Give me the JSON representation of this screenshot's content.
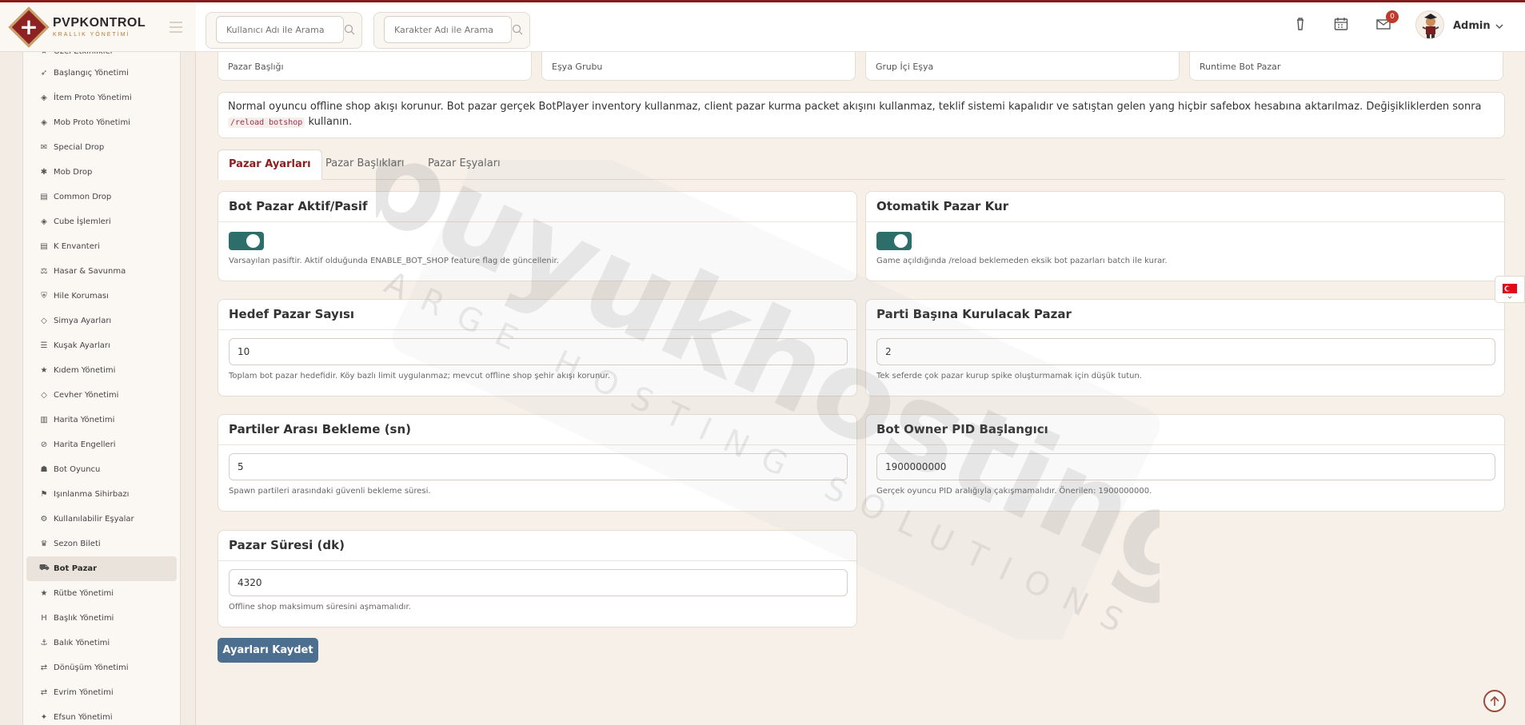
{
  "brand": {
    "name": "PVPKONTROL",
    "subtitle": "KRALLIK YÖNETİMİ"
  },
  "header": {
    "search_user_placeholder": "Kullanıcı Adı ile Arama",
    "search_char_placeholder": "Karakter Adı ile Arama",
    "notification_count": "0",
    "user_name": "Admin"
  },
  "sidebar": {
    "items": [
      {
        "label": "Özel Etkinlikler",
        "icon": "star-icon"
      },
      {
        "label": "Başlangıç Yönetimi",
        "icon": "rocket-icon"
      },
      {
        "label": "İtem Proto Yönetimi",
        "icon": "cube-icon"
      },
      {
        "label": "Mob Proto Yönetimi",
        "icon": "cube-icon"
      },
      {
        "label": "Special Drop",
        "icon": "gift-icon"
      },
      {
        "label": "Mob Drop",
        "icon": "bug-icon"
      },
      {
        "label": "Common Drop",
        "icon": "table-icon"
      },
      {
        "label": "Cube İşlemleri",
        "icon": "cube-icon"
      },
      {
        "label": "K Envanteri",
        "icon": "table-icon"
      },
      {
        "label": "Hasar & Savunma",
        "icon": "scale-icon"
      },
      {
        "label": "Hile Koruması",
        "icon": "shield-icon"
      },
      {
        "label": "Simya Ayarları",
        "icon": "gem-icon"
      },
      {
        "label": "Kuşak Ayarları",
        "icon": "sliders-icon"
      },
      {
        "label": "Kıdem Yönetimi",
        "icon": "star-icon"
      },
      {
        "label": "Cevher Yönetimi",
        "icon": "gem-icon"
      },
      {
        "label": "Harita Yönetimi",
        "icon": "map-icon"
      },
      {
        "label": "Harita Engelleri",
        "icon": "ban-icon"
      },
      {
        "label": "Bot Oyuncu",
        "icon": "android-icon"
      },
      {
        "label": "Işınlanma Sihirbazı",
        "icon": "signpost-icon"
      },
      {
        "label": "Kullanılabilir Eşyalar",
        "icon": "gears-icon"
      },
      {
        "label": "Sezon Bileti",
        "icon": "trophy-icon"
      },
      {
        "label": "Bot Pazar",
        "icon": "cart-icon",
        "active": true
      },
      {
        "label": "Rütbe Yönetimi",
        "icon": "star-icon"
      },
      {
        "label": "Başlık Yönetimi",
        "icon": "heading-icon"
      },
      {
        "label": "Balık Yönetimi",
        "icon": "anchor-icon"
      },
      {
        "label": "Dönüşüm Yönetimi",
        "icon": "shuffle-icon"
      },
      {
        "label": "Evrim Yönetimi",
        "icon": "shuffle-icon"
      },
      {
        "label": "Efsun Yönetimi",
        "icon": "wand-icon"
      }
    ]
  },
  "stats": [
    {
      "label": "Pazar Başlığı"
    },
    {
      "label": "Eşya Grubu"
    },
    {
      "label": "Grup İçi Eşya"
    },
    {
      "label": "Runtime Bot Pazar"
    }
  ],
  "info": {
    "text": "Normal oyuncu offline shop akışı korunur. Bot pazar gerçek BotPlayer inventory kullanmaz, client pazar kurma packet akışını kullanmaz, teklif sistemi kapalıdır ve satıştan gelen yang hiçbir safebox hesabına aktarılmaz. Değişikliklerden sonra",
    "code": "/reload botshop",
    "suffix": "kullanın."
  },
  "tabs": [
    "Pazar Ayarları",
    "Pazar Başlıkları",
    "Pazar Eşyaları"
  ],
  "settings": {
    "bot_enabled": {
      "title": "Bot Pazar Aktif/Pasif",
      "help": "Varsayılan pasiftir. Aktif olduğunda ENABLE_BOT_SHOP feature flag de güncellenir.",
      "on": true
    },
    "auto_setup": {
      "title": "Otomatik Pazar Kur",
      "help": "Game açıldığında /reload beklemeden eksik bot pazarları batch ile kurar.",
      "on": true
    },
    "target_count": {
      "title": "Hedef Pazar Sayısı",
      "value": "10",
      "help": "Toplam bot pazar hedefidir. Köy bazlı limit uygulanmaz; mevcut offline shop şehir akışı korunur."
    },
    "per_batch": {
      "title": "Parti Başına Kurulacak Pazar",
      "value": "2",
      "help": "Tek seferde çok pazar kurup spike oluşturmamak için düşük tutun."
    },
    "batch_delay": {
      "title": "Partiler Arası Bekleme (sn)",
      "value": "5",
      "help": "Spawn partileri arasındaki güvenli bekleme süresi."
    },
    "pid_start": {
      "title": "Bot Owner PID Başlangıcı",
      "value": "1900000000",
      "help": "Gerçek oyuncu PID aralığıyla çakışmamalıdır. Önerilen: 1900000000."
    },
    "duration": {
      "title": "Pazar Süresi (dk)",
      "value": "4320",
      "help": "Offline shop maksimum süresini aşmamalıdır."
    }
  },
  "save_label": "Ayarları Kaydet",
  "watermark": {
    "main": "buyukhosting",
    "sub": "LARGE HOSTING SOLUTIONS"
  },
  "colors": {
    "accent": "#8a1e1e",
    "toggle": "#2e6e6a",
    "button": "#4c6e8f",
    "background": "#f6f0e9"
  }
}
